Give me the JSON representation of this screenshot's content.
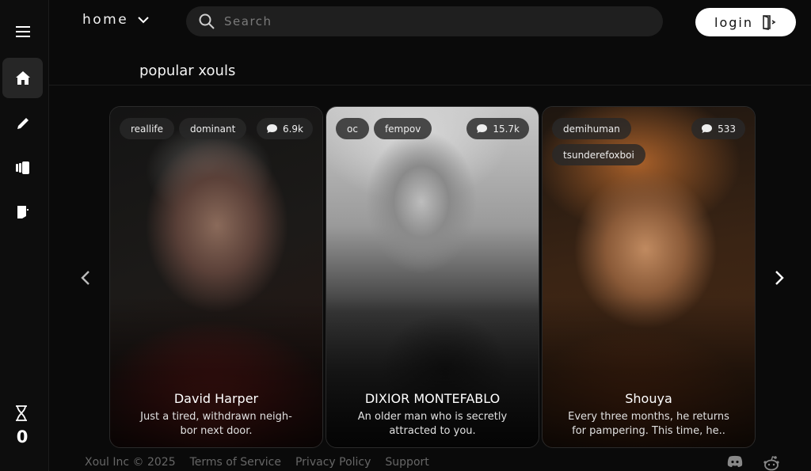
{
  "topbar": {
    "home_label": "home",
    "search_placeholder": "Search",
    "login_label": "login"
  },
  "section_title": "popular xouls",
  "sidebar": {
    "credits": "0"
  },
  "cards": [
    {
      "tags": [
        "reallife",
        "dominant"
      ],
      "count": "6.9k",
      "name": "David Harper",
      "description": "Just a tired, withdrawn neigh-bor next door."
    },
    {
      "tags": [
        "oc",
        "fempov"
      ],
      "count": "15.7k",
      "name": "DIXIOR MONTEFABLO",
      "description": "An older man who is secretly attracted to you."
    },
    {
      "tags": [
        "demihuman",
        "tsunderefoxboi"
      ],
      "count": "533",
      "name": "Shouya",
      "description": "Every three months, he returns for pampering. This time, he.."
    }
  ],
  "footer": {
    "copyright": "Xoul Inc © 2025",
    "terms": "Terms of Service",
    "privacy": "Privacy Policy",
    "support": "Support"
  },
  "colors": {
    "background": "#0a0a0a",
    "sidebar": "#0d0d0d",
    "search_bg": "#1f1f1f",
    "login_bg": "#ffffff",
    "tag_bg": "#282828"
  },
  "icons": [
    "menu-icon",
    "home-icon",
    "pencil-icon",
    "cards-icon",
    "door-icon",
    "hourglass-icon",
    "chevron-down-icon",
    "search-icon",
    "login-door-icon",
    "chevron-left-icon",
    "chevron-right-icon",
    "chat-bubble-icon",
    "discord-icon",
    "reddit-icon"
  ]
}
